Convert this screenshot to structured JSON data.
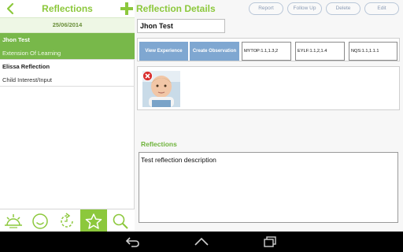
{
  "left_pane": {
    "title": "Reflections",
    "date": "25/06/2014",
    "items": [
      {
        "name": "Jhon Test",
        "subtitle": "Extension Of Learning",
        "selected": true
      },
      {
        "name": "Elissa Reflection",
        "subtitle": "Child Interest/Input",
        "selected": false
      }
    ],
    "tabs": [
      {
        "icon": "sunrise-icon"
      },
      {
        "icon": "smiley-icon"
      },
      {
        "icon": "refresh-arrow-icon"
      },
      {
        "icon": "star-icon",
        "active": true
      },
      {
        "icon": "search-icon"
      }
    ]
  },
  "right_pane": {
    "title": "Reflection Details",
    "buttons": {
      "report": "Report",
      "follow_up": "Follow Up",
      "delete": "Delete",
      "edit": "Edit"
    },
    "name_value": "Jhon Test",
    "actions": {
      "view_experience": "View Experience",
      "create_observation": "Create Observation"
    },
    "codes": {
      "mytop": "MYTOP:1.1,1.3,2",
      "eylf": "EYLF:1.1,2,1.4",
      "nqs": "NQS:1.1,1.1.1"
    },
    "reflections_label": "Reflections",
    "reflection_text": "Test reflection description"
  },
  "colors": {
    "brand_green": "#8cc83c",
    "selected_row": "#78b84a",
    "action_blue": "#7fa7d1"
  }
}
